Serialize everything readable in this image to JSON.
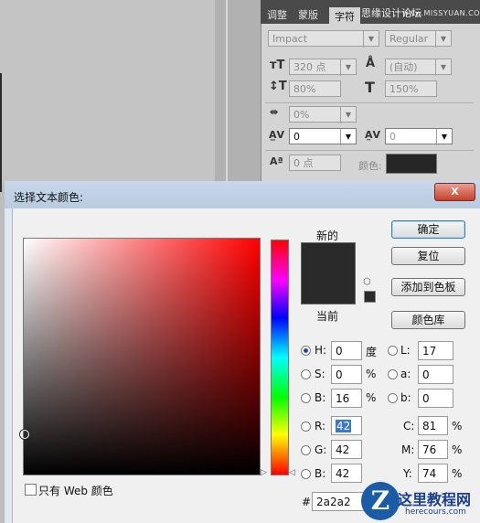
{
  "panel": {
    "tabs": [
      "调整",
      "蒙版",
      "字符"
    ],
    "watermark_cn": "思缘设计论坛",
    "watermark_url": "www.MISSYUAN.COM",
    "font_family": "Impact",
    "font_style": "Regular",
    "font_size": "320 点",
    "leading": "(自动)",
    "vscale": "80%",
    "hscale": "150%",
    "tsume": "0%",
    "kerning": "0",
    "tracking": "0",
    "baseline": "0 点",
    "color_label": "颜色:"
  },
  "dialog": {
    "title": "选择文本颜色:",
    "close_label": "X",
    "new_label": "新的",
    "current_label": "当前",
    "buttons": {
      "ok": "确定",
      "reset": "复位",
      "add_swatch": "添加到色板",
      "libraries": "颜色库"
    },
    "fields": {
      "H": {
        "label": "H:",
        "value": "0",
        "unit": "度"
      },
      "S": {
        "label": "S:",
        "value": "0",
        "unit": "%"
      },
      "B": {
        "label": "B:",
        "value": "16",
        "unit": "%"
      },
      "R": {
        "label": "R:",
        "value": "42"
      },
      "G": {
        "label": "G:",
        "value": "42"
      },
      "Bl": {
        "label": "B:",
        "value": "42"
      },
      "L": {
        "label": "L:",
        "value": "17"
      },
      "a": {
        "label": "a:",
        "value": "0"
      },
      "b": {
        "label": "b:",
        "value": "0"
      },
      "C": {
        "label": "C:",
        "value": "81",
        "unit": "%"
      },
      "M": {
        "label": "M:",
        "value": "76",
        "unit": "%"
      },
      "Y": {
        "label": "Y:",
        "value": "74",
        "unit": "%"
      }
    },
    "hex_label": "#",
    "hex_value": "2a2a2",
    "web_only_label": "只有 Web 颜色",
    "selected_color": "#2a2a2a"
  },
  "site_watermark": {
    "logo": "Z",
    "name": "这里教程网",
    "url": "herecours.com"
  }
}
